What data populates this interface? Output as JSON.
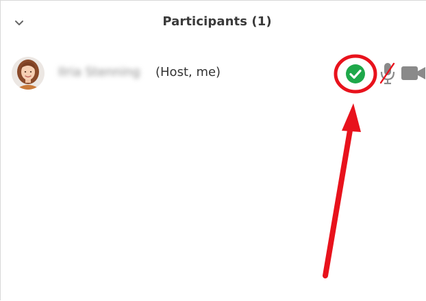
{
  "panel": {
    "title": "Participants (1)",
    "collapse_icon": "chevron-down-icon"
  },
  "participants": [
    {
      "name": "Ilria Stenning",
      "role_suffix": "(Host, me)",
      "status": "ready",
      "status_color": "#1ea84a",
      "mic": "muted",
      "video": "on"
    }
  ],
  "annotation": {
    "color": "#e8121c"
  }
}
